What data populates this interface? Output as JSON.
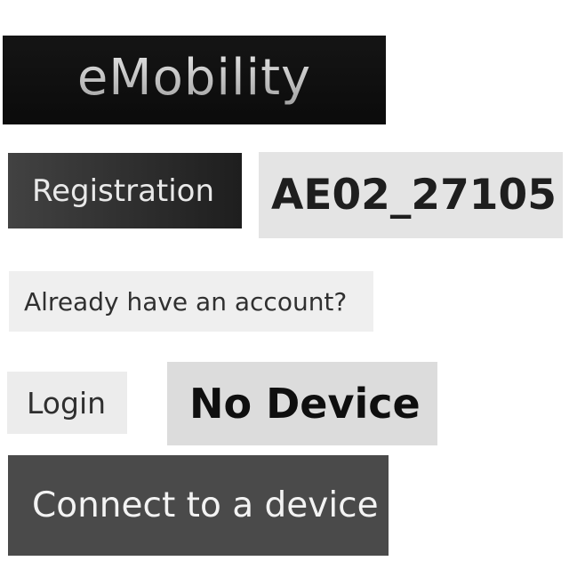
{
  "branding": {
    "logo_text": "eMobility"
  },
  "registration": {
    "button_label": "Registration",
    "device_id": "AE02_27105"
  },
  "account": {
    "prompt": "Already have an account?",
    "login_label": "Login"
  },
  "device": {
    "status": "No Device",
    "connect_label": "Connect to a device"
  }
}
